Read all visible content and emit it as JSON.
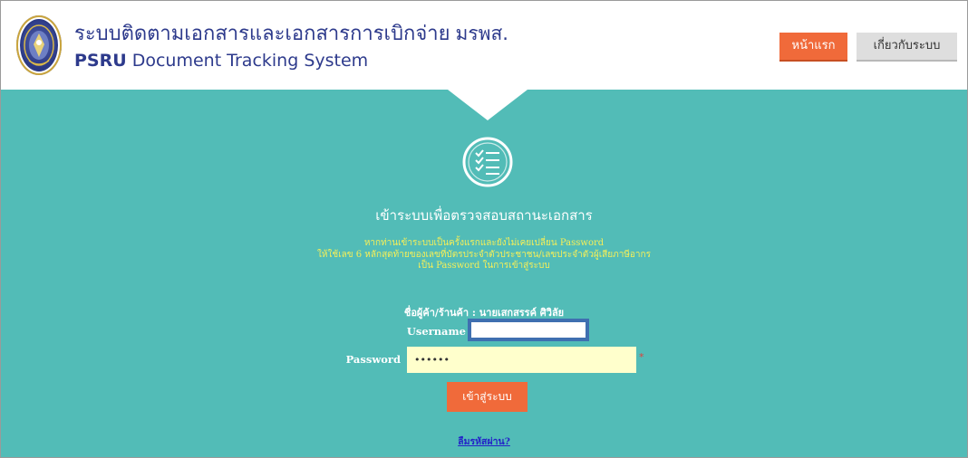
{
  "header": {
    "title_th": "ระบบติดตามเอกสารและเอกสารการเบิกจ่าย",
    "title_th_suffix": "มรพส.",
    "title_en_brand": "PSRU",
    "title_en_rest": " Document Tracking System",
    "logo_icon": "university-seal-icon"
  },
  "nav": {
    "home_label": "หน้าแรก",
    "about_label": "เกี่ยวกับระบบ"
  },
  "login": {
    "icon": "checklist-icon",
    "heading": "เข้าระบบเพื่อตรวจสอบสถานะเอกสาร",
    "notice_lines": [
      "หากท่านเข้าระบบเป็นครั้งแรกและยังไม่เคยเปลี่ยน Password",
      "ให้ใช้เลข 6 หลักสุดท้ายของเลขที่บัตรประจำตัวประชาชน/เลขประจำตัวผู้เสียภาษีอากร",
      "เป็น Password ในการเข้าสู่ระบบ"
    ],
    "vendor_label": "ชื่อผู้ค้า/ร้านค้า : นายเสกสรรค์ ศิวิลัย",
    "username_label": "Username",
    "username_value": "",
    "password_label": "Password",
    "password_value": "••••••",
    "required_mark": "*",
    "submit_label": "เข้าสู่ระบบ",
    "forgot_label": "ลืมรหัสผ่าน?"
  },
  "colors": {
    "brand_blue": "#2d3a8c",
    "accent_orange": "#f06a3a",
    "teal_background": "#52bcb7",
    "notice_yellow": "#f5ef58"
  }
}
